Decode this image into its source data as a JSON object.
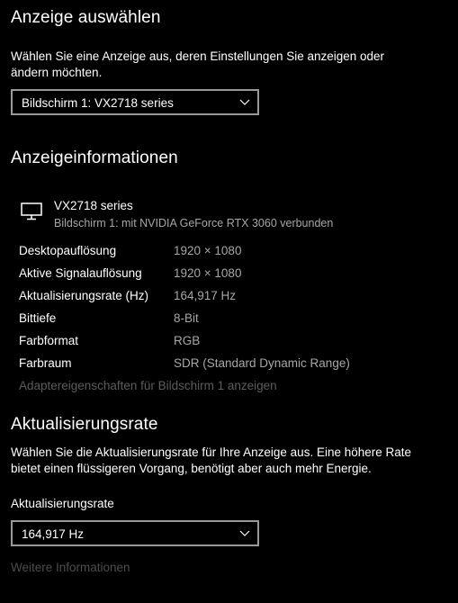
{
  "display_select": {
    "heading": "Anzeige auswählen",
    "description": "Wählen Sie eine Anzeige aus, deren Einstellungen Sie anzeigen oder ändern möchten.",
    "dropdown_value": "Bildschirm 1: VX2718 series"
  },
  "display_info": {
    "heading": "Anzeigeinformationen",
    "monitor_name": "VX2718 series",
    "monitor_sub": "Bildschirm 1: mit NVIDIA GeForce RTX 3060 verbunden",
    "rows": [
      {
        "label": "Desktopauflösung",
        "value": "1920 × 1080"
      },
      {
        "label": "Aktive Signalauflösung",
        "value": "1920 × 1080"
      },
      {
        "label": "Aktualisierungsrate (Hz)",
        "value": "164,917 Hz"
      },
      {
        "label": "Bittiefe",
        "value": "8-Bit"
      },
      {
        "label": "Farbformat",
        "value": "RGB"
      },
      {
        "label": "Farbraum",
        "value": "SDR (Standard Dynamic Range)"
      }
    ],
    "adapter_link": "Adaptereigenschaften für Bildschirm 1 anzeigen"
  },
  "refresh_rate": {
    "heading": "Aktualisierungsrate",
    "description": "Wählen Sie die Aktualisierungsrate für Ihre Anzeige aus. Eine höhere Rate bietet einen flüssigeren Vorgang, benötigt aber auch mehr Energie.",
    "field_label": "Aktualisierungsrate",
    "dropdown_value": "164,917 Hz",
    "more_info_link": "Weitere Informationen"
  },
  "icons": {
    "monitor": "monitor-icon",
    "chevron": "chevron-down-icon"
  },
  "colors": {
    "background": "#000000",
    "text": "#ffffff",
    "secondary_text": "#a6a6a6",
    "disabled_text": "#5c5c5c",
    "dropdown_border": "#999999"
  }
}
